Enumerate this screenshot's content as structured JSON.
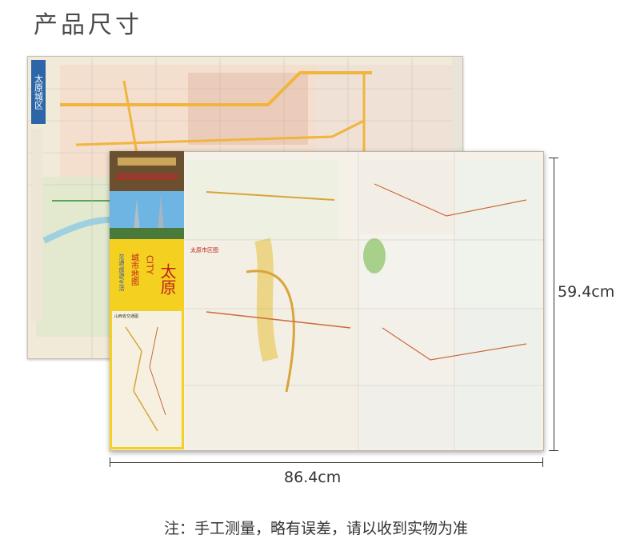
{
  "page": {
    "title": "产品尺寸"
  },
  "product": {
    "back_map_label": "太原城区",
    "front_map_label": "太原市区图",
    "cover": {
      "city_name": "太原",
      "subtitle_en": "CITY",
      "map_type": "城市地图",
      "tagline": "交通/旅游/生活",
      "inset_label": "山西省交通图"
    }
  },
  "dimensions": {
    "width": "86.4cm",
    "height": "59.4cm"
  },
  "note": "注：手工测量，略有误差，请以收到实物为准"
}
